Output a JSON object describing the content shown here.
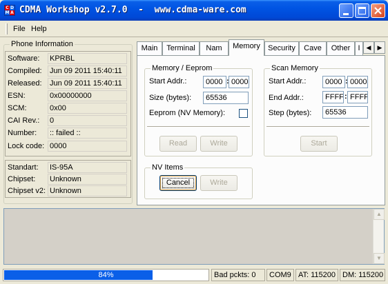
{
  "window": {
    "title": "CDMA Workshop v2.7.0  -  www.cdma-ware.com"
  },
  "menu": {
    "items": [
      "File",
      "Help"
    ]
  },
  "phone_info": {
    "title": "Phone Information",
    "rows": [
      {
        "label": "Software:",
        "value": "KPRBL"
      },
      {
        "label": "Compiled:",
        "value": "Jun 09 2011 15:40:11"
      },
      {
        "label": "Released:",
        "value": "Jun 09 2011 15:40:11"
      },
      {
        "label": "ESN:",
        "value": "0x00000000"
      },
      {
        "label": "SCM:",
        "value": "0x00"
      },
      {
        "label": "CAI Rev.:",
        "value": "0"
      },
      {
        "label": "Number:",
        "value": ":: failed ::"
      },
      {
        "label": "Lock code:",
        "value": "0000"
      }
    ],
    "rows2": [
      {
        "label": "Standart:",
        "value": "IS-95A"
      },
      {
        "label": "Chipset:",
        "value": "Unknown"
      },
      {
        "label": "Chipset v2:",
        "value": "Unknown"
      }
    ]
  },
  "tabs": {
    "items": [
      "Main",
      "Terminal",
      "Nam",
      "Memory",
      "Security",
      "Cave",
      "Other",
      "I"
    ],
    "active": "Memory",
    "scroll_left": "◀",
    "scroll_right": "▶"
  },
  "memory_eeprom": {
    "title": "Memory / Eeprom",
    "start_label": "Start Addr.:",
    "start_hi": "0000",
    "start_lo": "0000",
    "size_label": "Size (bytes):",
    "size_value": "65536",
    "eeprom_label": "Eeprom (NV Memory):",
    "eeprom_checked": false,
    "read_button": "Read",
    "write_button": "Write"
  },
  "scan_memory": {
    "title": "Scan Memory",
    "start_label": "Start Addr.:",
    "start_hi": "0000",
    "start_lo": "0000",
    "end_label": "End Addr.:",
    "end_hi": "FFFF",
    "end_lo": "FFFF",
    "step_label": "Step (bytes):",
    "step_value": "65536",
    "start_button": "Start"
  },
  "nv_items": {
    "title": "NV Items",
    "cancel_button": "Cancel",
    "write_button": "Write"
  },
  "colon": ":",
  "status": {
    "progress_percent": 84,
    "progress_text": "84%",
    "bad_packets": "Bad pckts: 0",
    "port": "COM9",
    "at_speed": "AT: 115200",
    "dm_speed": "DM: 115200"
  },
  "colors": {
    "titlebar": "#0054e3",
    "progress": "#0a5fe8",
    "log_background": "#d4d0c8"
  }
}
